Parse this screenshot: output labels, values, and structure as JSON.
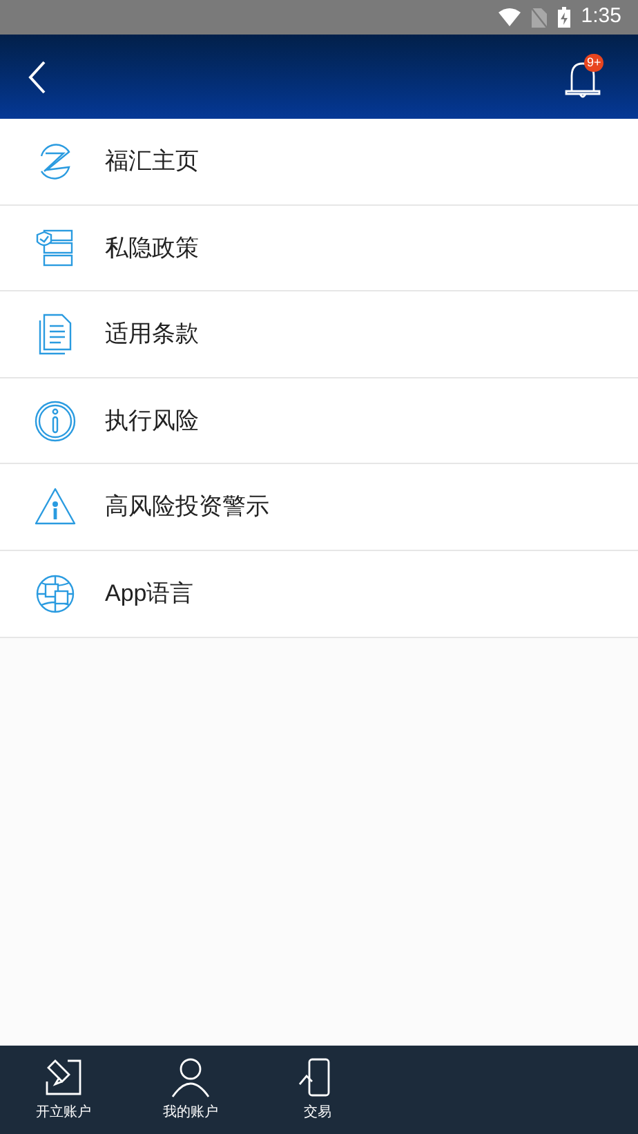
{
  "status_bar": {
    "time": "1:35"
  },
  "header": {
    "badge": "9+"
  },
  "menu": [
    {
      "kind": "home",
      "label": "福汇主页"
    },
    {
      "kind": "privacy",
      "label": "私隐政策"
    },
    {
      "kind": "terms",
      "label": "适用条款"
    },
    {
      "kind": "risk",
      "label": "执行风险"
    },
    {
      "kind": "warning",
      "label": "高风险投资警示"
    },
    {
      "kind": "language",
      "label": "App语言"
    }
  ],
  "tab_bar": [
    {
      "kind": "open",
      "label": "开立账户"
    },
    {
      "kind": "account",
      "label": "我的账户"
    },
    {
      "kind": "trade",
      "label": "交易"
    }
  ]
}
